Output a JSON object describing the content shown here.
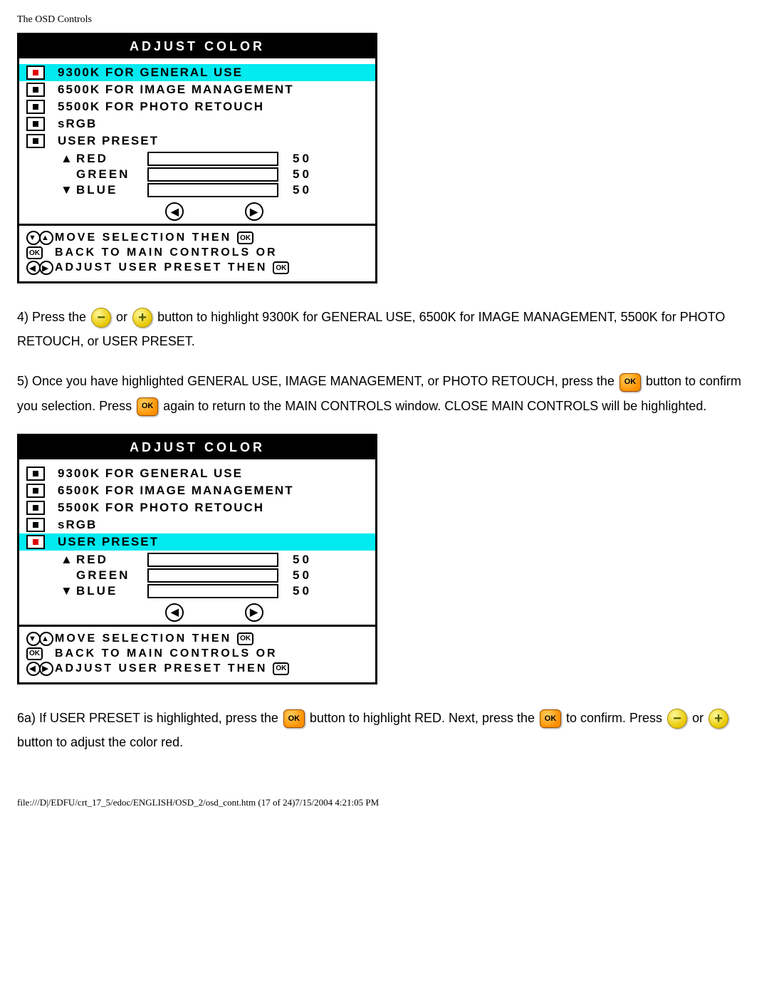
{
  "page_header": "The OSD Controls",
  "osd1": {
    "title": "ADJUST COLOR",
    "highlighted_index": 0,
    "options": [
      "9300K FOR GENERAL USE",
      "6500K FOR IMAGE MANAGEMENT",
      "5500K FOR PHOTO RETOUCH",
      "sRGB",
      "USER PRESET"
    ],
    "preset": {
      "red_label": "RED",
      "red_val": "50",
      "green_label": "GREEN",
      "green_val": "50",
      "blue_label": "BLUE",
      "blue_val": "50"
    },
    "footer": {
      "l1": "MOVE SELECTION THEN",
      "l2": "BACK TO MAIN CONTROLS OR",
      "l3": "ADJUST USER PRESET THEN"
    }
  },
  "para4": {
    "a": "4) Press the ",
    "b": " or ",
    "c": " button to highlight 9300K for GENERAL USE, 6500K for IMAGE MANAGEMENT, 5500K for PHOTO RETOUCH, or USER PRESET."
  },
  "para5": {
    "a": "5) Once you have highlighted GENERAL USE, IMAGE MANAGEMENT, or PHOTO RETOUCH, press the ",
    "b": " button to confirm you selection. Press ",
    "c": " again to return to the MAIN CONTROLS window. CLOSE MAIN CONTROLS will be highlighted."
  },
  "osd2": {
    "title": "ADJUST COLOR",
    "highlighted_index": 4,
    "options": [
      "9300K FOR GENERAL USE",
      "6500K FOR IMAGE MANAGEMENT",
      "5500K FOR PHOTO RETOUCH",
      "sRGB",
      "USER PRESET"
    ],
    "preset": {
      "red_label": "RED",
      "red_val": "50",
      "green_label": "GREEN",
      "green_val": "50",
      "blue_label": "BLUE",
      "blue_val": "50"
    },
    "footer": {
      "l1": "MOVE SELECTION THEN",
      "l2": "BACK TO MAIN CONTROLS OR",
      "l3": "ADJUST USER PRESET THEN"
    }
  },
  "para6": {
    "a": "6a) If USER PRESET is highlighted, press the ",
    "b": " button to highlight RED. Next, press the ",
    "c": " to confirm. Press ",
    "d": " or ",
    "e": " button to adjust the color red."
  },
  "page_footer": "file:///D|/EDFU/crt_17_5/edoc/ENGLISH/OSD_2/osd_cont.htm (17 of 24)7/15/2004 4:21:05 PM"
}
